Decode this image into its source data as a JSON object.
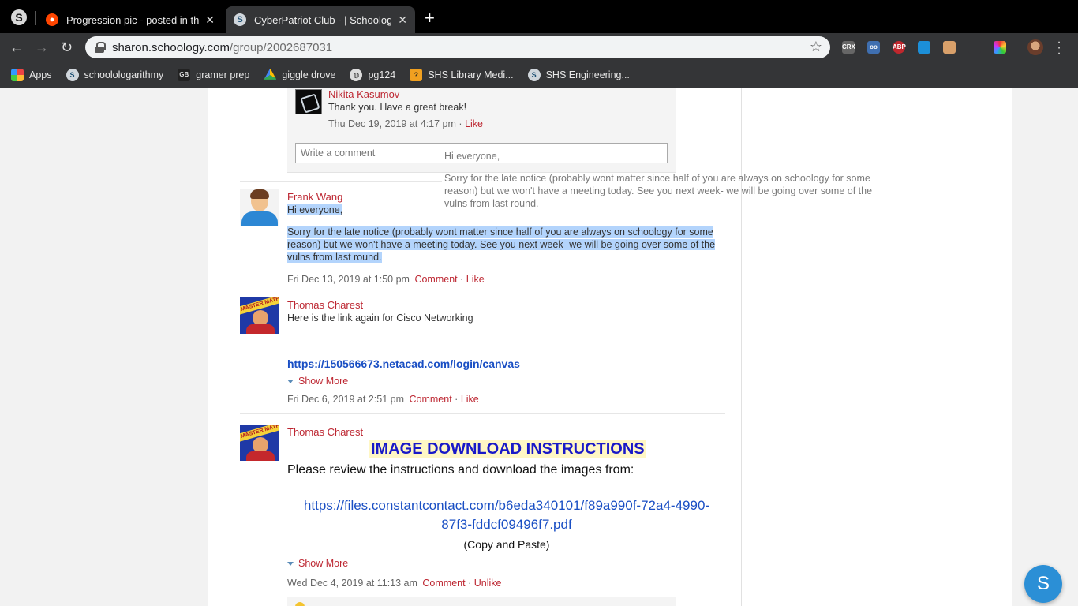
{
  "browser": {
    "tabs": [
      {
        "title": "Progression pic - posted in the",
        "favicon": "reddit-icon",
        "active": false
      },
      {
        "title": "CyberPatriot Club - | Schoolog",
        "favicon": "schoology-icon",
        "active": true
      }
    ],
    "new_tab_label": "+",
    "close_glyph": "✕",
    "url_host": "sharon.schoology.com",
    "url_path": "/group/2002687031",
    "bookmarks": [
      {
        "label": "Apps",
        "icon": "apps-grid-icon"
      },
      {
        "label": "schoolologarithmy",
        "icon": "schoology-icon"
      },
      {
        "label": "gramer prep",
        "icon": "gb-icon"
      },
      {
        "label": "giggle drove",
        "icon": "google-drive-icon"
      },
      {
        "label": "pg124",
        "icon": "globe-icon"
      },
      {
        "label": "SHS Library Medi...",
        "icon": "library-icon"
      },
      {
        "label": "SHS Engineering...",
        "icon": "schoology-icon"
      }
    ],
    "extensions": [
      "CRX",
      "oo",
      "ABP",
      "",
      "",
      "",
      "",
      ""
    ]
  },
  "feed": {
    "reply": {
      "author": "Nikita Kasumov",
      "text": "Thank you. Have a great break!",
      "timestamp": "Thu Dec 19, 2019 at 4:17 pm",
      "sep": "·",
      "like": "Like"
    },
    "write_comment_placeholder": "Write a comment",
    "posts": [
      {
        "author": "Frank Wang",
        "greeting": "Hi everyone,",
        "body": "Sorry for the late notice (probably wont matter since half of you are always on schoology for some reason) but we won't have a meeting today. See you next week- we will be going over some of the vulns from last round.",
        "timestamp": "Fri Dec 13, 2019 at 1:50 pm",
        "comment": "Comment",
        "sep": "·",
        "like": "Like"
      },
      {
        "author": "Thomas Charest",
        "text": "Here is the link again for Cisco Networking",
        "link": "https://150566673.netacad.com/login/canvas",
        "show_more": "Show More",
        "timestamp": "Fri Dec 6, 2019 at 2:51 pm",
        "comment": "Comment",
        "sep": "·",
        "like": "Like"
      },
      {
        "author": "Thomas Charest",
        "heading": "IMAGE DOWNLOAD INSTRUCTIONS",
        "text": "Please review the instructions and download the images from:",
        "link_line1": "https://files.constantcontact.com/b6eda340101/f89a990f-72a4-4990-",
        "link_line2": "87f3-fddcf09496f7.pdf",
        "note": "(Copy and Paste)",
        "show_more": "Show More",
        "timestamp": "Wed Dec 4, 2019 at 11:13 am",
        "comment": "Comment",
        "sep": "·",
        "like": "Unlike"
      }
    ],
    "drag_ghost": {
      "line1": "Hi everyone,",
      "line2": "Sorry for the late notice (probably wont matter since half of you are always on schoology for some",
      "line3": "reason) but we won't have a meeting today. See you next week- we will be going over some of the",
      "line4": "vulns from last round."
    }
  },
  "fab_label": "S",
  "colors": {
    "accent_red": "#bd2732",
    "link_blue": "#1a4fc4",
    "selection": "#b3d4fc",
    "fab": "#2b8fd6"
  }
}
